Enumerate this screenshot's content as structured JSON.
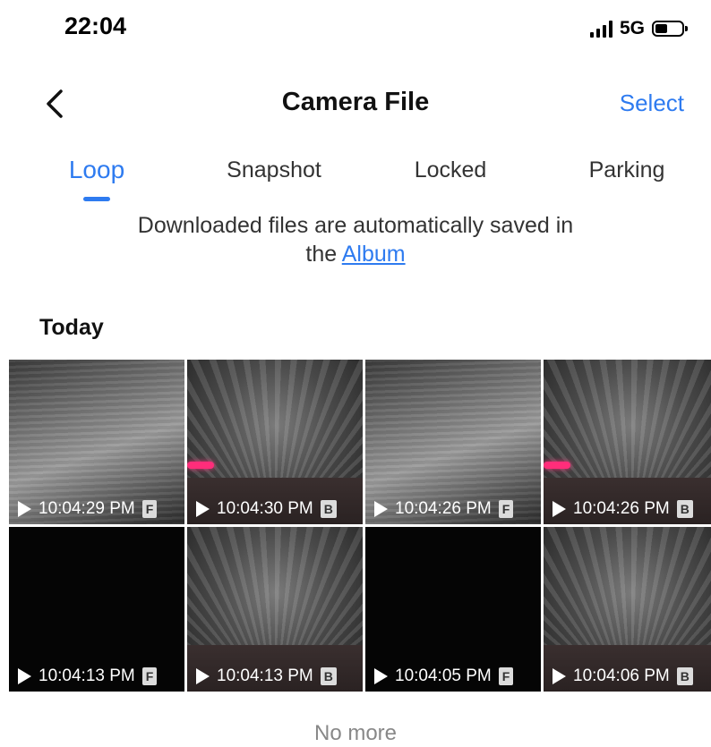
{
  "status_bar": {
    "time": "22:04",
    "network": "5G"
  },
  "header": {
    "title": "Camera File",
    "select_label": "Select"
  },
  "tabs": [
    {
      "label": "Loop",
      "active": true
    },
    {
      "label": "Snapshot",
      "active": false
    },
    {
      "label": "Locked",
      "active": false
    },
    {
      "label": "Parking",
      "active": false
    }
  ],
  "notice": {
    "text_line1": "Downloaded files are automatically saved in",
    "text_prefix": "the",
    "link_label": "Album"
  },
  "section": {
    "title": "Today"
  },
  "videos": [
    {
      "time": "10:04:29 PM",
      "badge": "F"
    },
    {
      "time": "10:04:30 PM",
      "badge": "B"
    },
    {
      "time": "10:04:26 PM",
      "badge": "F"
    },
    {
      "time": "10:04:26 PM",
      "badge": "B"
    },
    {
      "time": "10:04:13 PM",
      "badge": "F"
    },
    {
      "time": "10:04:13 PM",
      "badge": "B"
    },
    {
      "time": "10:04:05 PM",
      "badge": "F"
    },
    {
      "time": "10:04:06 PM",
      "badge": "B"
    }
  ],
  "footer": {
    "no_more": "No more"
  },
  "colors": {
    "accent": "#2e7bf0",
    "highlight_pink": "#ff2d7a"
  }
}
